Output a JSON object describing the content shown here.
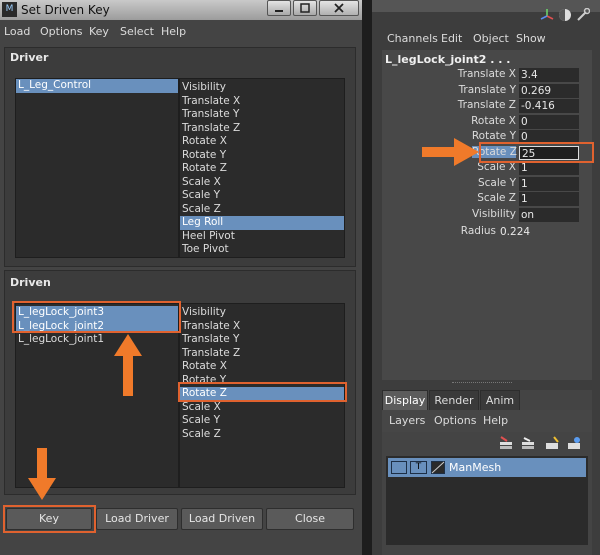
{
  "sdk": {
    "title": "Set Driven Key",
    "app_icon": "M",
    "menus": [
      "Load",
      "Options",
      "Key",
      "Select",
      "Help"
    ],
    "driver": {
      "header": "Driver",
      "objects": [
        "L_Leg_Control"
      ],
      "attributes": [
        "Visibility",
        "Translate X",
        "Translate Y",
        "Translate Z",
        "Rotate X",
        "Rotate Y",
        "Rotate Z",
        "Scale X",
        "Scale Y",
        "Scale Z",
        "Leg Roll",
        "Heel Pivot",
        "Toe Pivot"
      ],
      "selected_attribute": "Leg Roll"
    },
    "driven": {
      "header": "Driven",
      "objects": [
        "L_legLock_joint3",
        "L_legLock_joint2",
        "L_legLock_joint1"
      ],
      "attributes": [
        "Visibility",
        "Translate X",
        "Translate Y",
        "Translate Z",
        "Rotate X",
        "Rotate Y",
        "Rotate Z",
        "Scale X",
        "Scale Y",
        "Scale Z"
      ],
      "selected_attribute": "Rotate Z"
    },
    "buttons": {
      "key": "Key",
      "load_driver": "Load Driver",
      "load_driven": "Load Driven",
      "close": "Close"
    }
  },
  "channel_box": {
    "menus": [
      "Channels",
      "Edit",
      "Object",
      "Show"
    ],
    "object_name": "L_legLock_joint2 . . .",
    "attributes": [
      {
        "label": "Translate X",
        "value": "3.4"
      },
      {
        "label": "Translate Y",
        "value": "0.269"
      },
      {
        "label": "Translate Z",
        "value": "-0.416"
      },
      {
        "label": "Rotate X",
        "value": "0"
      },
      {
        "label": "Rotate Y",
        "value": "0"
      },
      {
        "label": "Rotate Z",
        "value": "25"
      },
      {
        "label": "Scale X",
        "value": "1"
      },
      {
        "label": "Scale Y",
        "value": "1"
      },
      {
        "label": "Scale Z",
        "value": "1"
      },
      {
        "label": "Visibility",
        "value": "on"
      }
    ],
    "radius": {
      "label": "Radius",
      "value": "0.224"
    }
  },
  "layer_editor": {
    "tabs": [
      "Display",
      "Render",
      "Anim"
    ],
    "menus": [
      "Layers",
      "Options",
      "Help"
    ],
    "layer": {
      "type_flag": "T",
      "name": "ManMesh"
    }
  },
  "colors": {
    "selection": "#6990bd",
    "highlight": "#e0622f",
    "arrow": "#f07a2a"
  }
}
